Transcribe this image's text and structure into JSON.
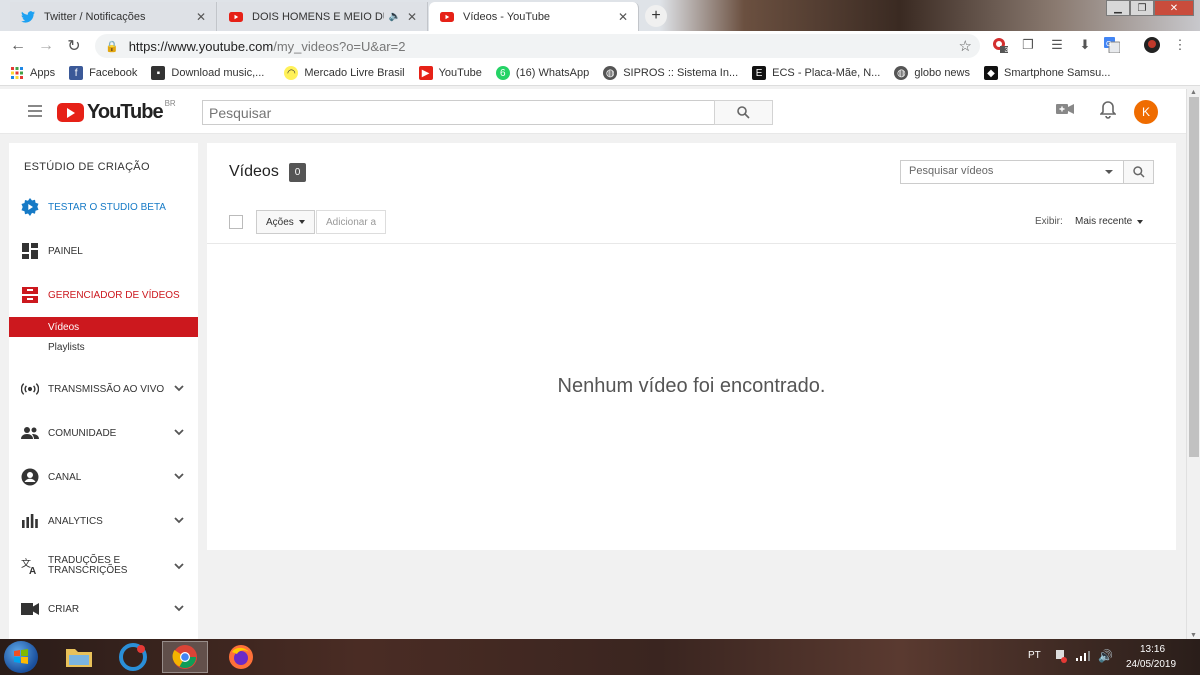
{
  "browser": {
    "tabs": [
      {
        "title": "Twitter / Notificações",
        "icon": "twitter-icon",
        "active": false
      },
      {
        "title": "DOIS HOMENS E MEIO DUBL",
        "icon": "youtube-icon",
        "active": false
      },
      {
        "title": "Vídeos - YouTube",
        "icon": "youtube-icon",
        "active": true
      }
    ],
    "new_tab": "+",
    "url_host": "https://www.youtube.com",
    "url_path": "/my_videos?o=U&ar=2",
    "bookmarks": [
      {
        "label": "Apps",
        "icon": "apps-grid-icon"
      },
      {
        "label": "Facebook",
        "icon": "facebook-icon"
      },
      {
        "label": "Download music,...",
        "icon": "download-car-icon"
      },
      {
        "label": "Mercado Livre Brasil",
        "icon": "mercadolivre-icon"
      },
      {
        "label": "YouTube",
        "icon": "youtube-icon"
      },
      {
        "label": "(16) WhatsApp",
        "icon": "whatsapp-icon"
      },
      {
        "label": "SIPROS :: Sistema In...",
        "icon": "globe-icon"
      },
      {
        "label": "ECS - Placa-Mãe, N...",
        "icon": "ecs-icon"
      },
      {
        "label": "globo news",
        "icon": "globe-icon"
      },
      {
        "label": "Smartphone Samsu...",
        "icon": "samsung-icon"
      }
    ],
    "extension_badge": "3"
  },
  "youtube": {
    "logo_text": "YouTube",
    "region": "BR",
    "search_placeholder": "Pesquisar",
    "avatar_letter": "K"
  },
  "sidebar": {
    "title": "ESTÚDIO DE CRIAÇÃO",
    "beta": "TESTAR O STUDIO BETA",
    "items": [
      {
        "label": "PAINEL",
        "icon": "dashboard-icon"
      },
      {
        "label": "GERENCIADOR DE VÍDEOS",
        "icon": "video-manager-icon"
      },
      {
        "label": "TRANSMISSÃO AO VIVO",
        "icon": "live-broadcast-icon"
      },
      {
        "label": "COMUNIDADE",
        "icon": "community-icon"
      },
      {
        "label": "CANAL",
        "icon": "channel-icon"
      },
      {
        "label": "ANALYTICS",
        "icon": "analytics-icon"
      },
      {
        "label": "TRADUÇÕES E TRANSCRIÇÕES",
        "icon": "translate-icon"
      },
      {
        "label": "CRIAR",
        "icon": "create-icon"
      }
    ],
    "subitems": [
      {
        "label": "Vídeos",
        "active": true
      },
      {
        "label": "Playlists",
        "active": false
      }
    ]
  },
  "main": {
    "title": "Vídeos",
    "count": "0",
    "search_placeholder": "Pesquisar vídeos",
    "actions_label": "Ações",
    "add_to_label": "Adicionar a",
    "show_label": "Exibir:",
    "sort_label": "Mais recente",
    "empty_message": "Nenhum vídeo foi encontrado."
  },
  "taskbar": {
    "language": "PT",
    "time": "13:16",
    "date": "24/05/2019"
  },
  "colors": {
    "youtube_red": "#e62117",
    "studio_red": "#cc181e",
    "beta_blue": "#167ac6",
    "avatar_orange": "#ef6c00"
  }
}
